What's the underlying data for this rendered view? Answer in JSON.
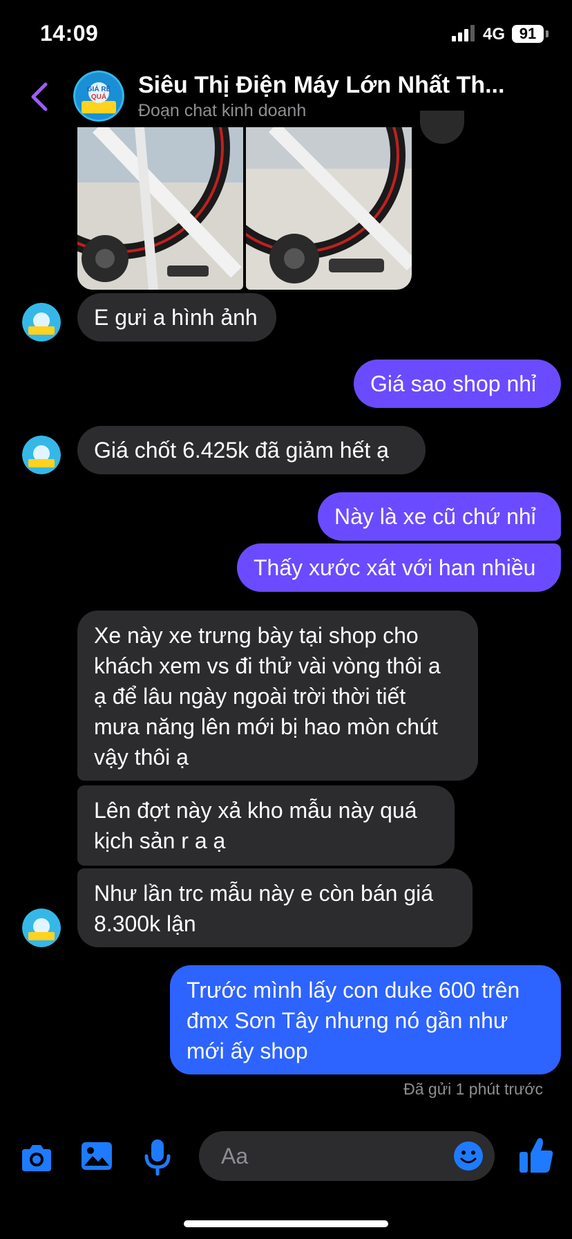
{
  "status": {
    "time": "14:09",
    "network": "4G",
    "battery": "91"
  },
  "header": {
    "title": "Siêu Thị Điện Máy Lớn Nhất Th...",
    "subtitle": "Đoạn chat kinh doanh",
    "avatar_badge_line1": "GIÁ RẺ",
    "avatar_badge_line2": "QUÁ"
  },
  "messages": [
    {
      "from": "shop",
      "text": "E gưi a hình ảnh"
    },
    {
      "from": "me",
      "text": "Giá sao shop nhỉ"
    },
    {
      "from": "shop",
      "text": "Giá chốt 6.425k đã giảm hết ạ"
    },
    {
      "from": "me",
      "text": "Này là xe cũ chứ nhỉ"
    },
    {
      "from": "me",
      "text": "Thấy xước xát với han nhiều"
    },
    {
      "from": "shop",
      "text": "Xe này xe trưng bày tại shop cho\nkhách xem vs đi thử vài vòng thôi a\nạ để lâu ngày ngoài trời thời tiết\nmưa năng lên mới bị hao mòn chút\nvậy thôi ạ"
    },
    {
      "from": "shop",
      "text": "Lên đợt này xả kho mẫu này quá\nkịch sản r a ạ"
    },
    {
      "from": "shop",
      "text": "Như lần trc mẫu này e còn bán giá\n8.300k lận"
    },
    {
      "from": "me",
      "text": "Trước mình lấy con duke 600 trên\nđmx Sơn Tây nhưng nó gần như\nmới ấy shop"
    }
  ],
  "receipt": "Đã gửi 1 phút trước",
  "composer": {
    "placeholder": "Aa"
  },
  "colors": {
    "sent_bubble": "#6b4bff",
    "last_sent_bubble": "#2d63ff",
    "received_bubble": "#2c2c2e",
    "accent": "#1e7bff",
    "back_arrow": "#9b5cff"
  }
}
